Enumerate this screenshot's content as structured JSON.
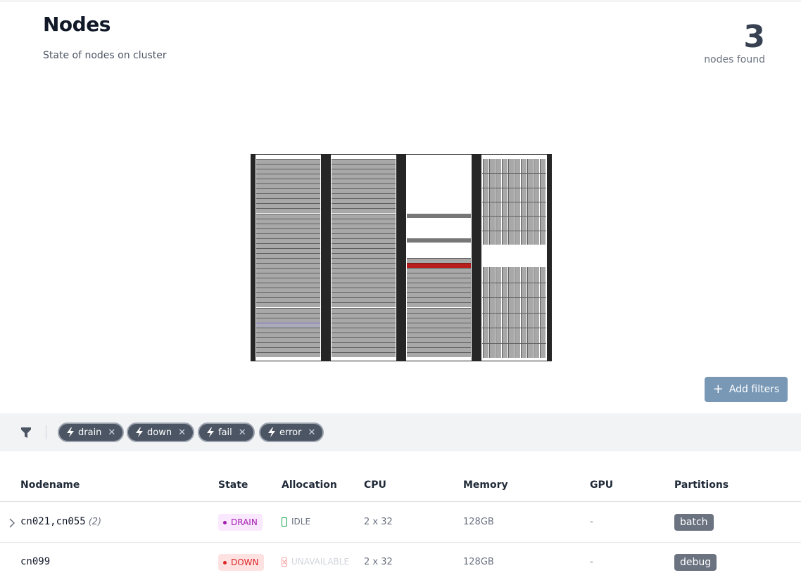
{
  "header": {
    "title": "Nodes",
    "subtitle": "State of nodes on cluster",
    "count": "3",
    "count_label": "nodes found"
  },
  "toolbar": {
    "add_filters_label": "Add filters",
    "add_filters_icon": "plus-icon"
  },
  "filters": {
    "icon": "funnel-icon",
    "chips": [
      {
        "label": "drain",
        "icon": "bolt-icon"
      },
      {
        "label": "down",
        "icon": "bolt-icon"
      },
      {
        "label": "fail",
        "icon": "bolt-icon"
      },
      {
        "label": "error",
        "icon": "bolt-icon"
      }
    ]
  },
  "table": {
    "columns": [
      "Nodename",
      "State",
      "Allocation",
      "CPU",
      "Memory",
      "GPU",
      "Partitions"
    ],
    "rows": [
      {
        "nodename": "cn021,cn055",
        "count": "(2)",
        "state": "DRAIN",
        "allocation": "IDLE",
        "cpu": "2 x 32",
        "memory": "128GB",
        "gpu": "-",
        "partition": "batch"
      },
      {
        "nodename": "cn099",
        "count": "",
        "state": "DOWN",
        "allocation": "UNAVAILABLE",
        "cpu": "2 x 32",
        "memory": "128GB",
        "gpu": "-",
        "partition": "debug"
      }
    ]
  },
  "colors": {
    "drain": "#a21caf",
    "down": "#dc2626",
    "idle": "#16a34a",
    "button": "#7898b6",
    "chip": "#4b5563"
  }
}
